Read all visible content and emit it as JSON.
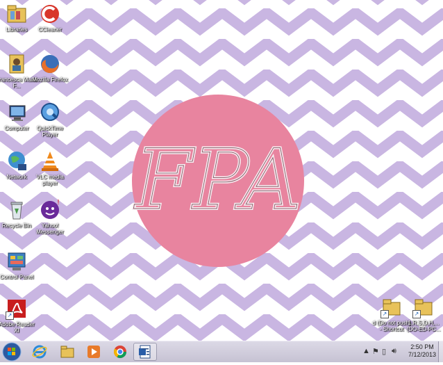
{
  "desktop": {
    "icons_left": [
      {
        "id": "libraries",
        "label": "Libraries",
        "icon": "libraries-icon"
      },
      {
        "id": "ccleaner",
        "label": "CCleaner",
        "icon": "ccleaner-icon"
      },
      {
        "id": "user-folder",
        "label": "Francesca Marie F...",
        "icon": "user-folder-icon"
      },
      {
        "id": "firefox",
        "label": "Mozilla Firefox",
        "icon": "firefox-icon"
      },
      {
        "id": "computer",
        "label": "Computer",
        "icon": "computer-icon"
      },
      {
        "id": "quicktime",
        "label": "QuickTime Player",
        "icon": "quicktime-icon"
      },
      {
        "id": "network",
        "label": "Network",
        "icon": "network-icon"
      },
      {
        "id": "vlc",
        "label": "VLC media player",
        "icon": "vlc-icon"
      },
      {
        "id": "recycle-bin",
        "label": "Recycle Bin",
        "icon": "recycle-bin-icon"
      },
      {
        "id": "yahoo",
        "label": "Yahoo! Messenger",
        "icon": "yahoo-messenger-icon"
      },
      {
        "id": "control-panel",
        "label": "Control Panel",
        "icon": "control-panel-icon"
      },
      {
        "id": "adobe",
        "label": "Adobe Reader XI",
        "icon": "adobe-reader-icon"
      }
    ],
    "icons_right": [
      {
        "id": "shortcut-1",
        "label": "d (Do not push) - Shortcut",
        "icon": "folder-shortcut-icon"
      },
      {
        "id": "shortcut-2",
        "label": "1,R,S,D,H,... (DO-ED-PC...",
        "icon": "folder-shortcut-icon"
      }
    ],
    "wallpaper": {
      "monogram": "FPA",
      "chevron_color": "#c9b6e2",
      "background_color": "#ffffff",
      "circle_color": "#e8849f"
    }
  },
  "taskbar": {
    "pinned": [
      {
        "id": "start",
        "icon": "windows-start-icon"
      },
      {
        "id": "ie",
        "icon": "internet-explorer-icon"
      },
      {
        "id": "explorer",
        "icon": "file-explorer-icon"
      },
      {
        "id": "media-player",
        "icon": "media-player-icon"
      },
      {
        "id": "chrome",
        "icon": "chrome-icon"
      },
      {
        "id": "word",
        "icon": "document-app-icon"
      }
    ],
    "clock_time": "2:50 PM",
    "clock_date": "7/12/2013"
  }
}
